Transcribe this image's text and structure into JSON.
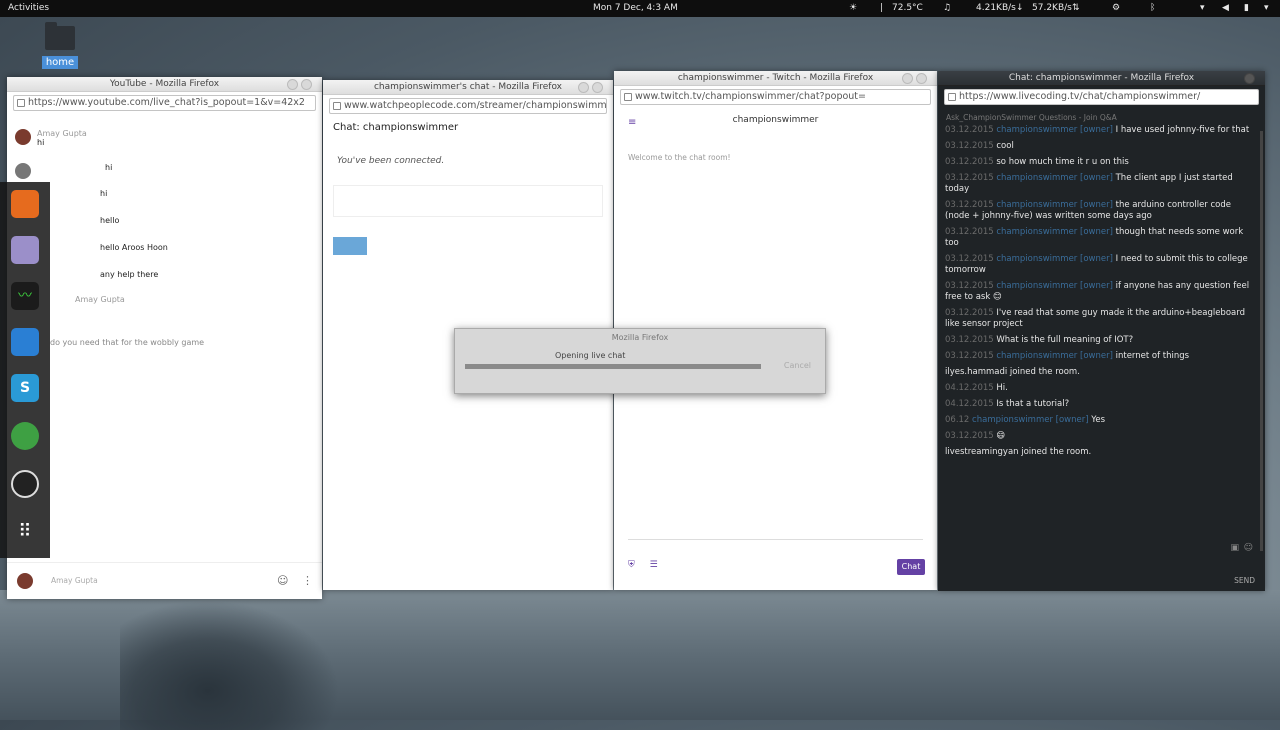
{
  "topbar": {
    "activities": "Activities",
    "clock": "Mon  7 Dec,  4:3 AM",
    "temp": "72.5°C",
    "net_down": "4.21KB/s",
    "net_up": "57.2KB/s"
  },
  "desktop": {
    "home_label": "home"
  },
  "youtube": {
    "title": "YouTube - Mozilla Firefox",
    "url": "https://www.youtube.com/live_chat?is_popout=1&v=42x2",
    "messages": [
      {
        "name": "Amay Gupta",
        "text": "hi"
      },
      {
        "name": "",
        "text": "hi"
      },
      {
        "name": "",
        "text": "hi"
      },
      {
        "name": "",
        "text": "hello"
      },
      {
        "name": "",
        "text": "hello Aroos Hoon"
      },
      {
        "name": "",
        "text": "any help there"
      },
      {
        "name": "Amay Gupta",
        "text": ""
      },
      {
        "name": "",
        "text": "do you need that for the wobbly game"
      }
    ],
    "bottom_name": "Amay Gupta"
  },
  "wpc": {
    "title": "championswimmer's chat - Mozilla Firefox",
    "url": "www.watchpeoplecode.com/streamer/championswimmer",
    "chat_title": "Chat: championswimmer",
    "connected": "You've been connected."
  },
  "twitch": {
    "title": "championswimmer - Twitch - Mozilla Firefox",
    "url": "www.twitch.tv/championswimmer/chat?popout=",
    "channel": "championswimmer",
    "welcome": "Welcome to the chat room!",
    "chat_button": "Chat"
  },
  "livecoding": {
    "title": "Chat: championswimmer - Mozilla Firefox",
    "url": "https://www.livecoding.tv/chat/championswimmer/",
    "subtitle": "Ask_ChampionSwimmer Questions - Join Q&A",
    "send": "SEND",
    "messages": [
      {
        "time": "03.12.2015",
        "user": "championswimmer [owner]",
        "text": "I have used johnny-five for that"
      },
      {
        "time": "03.12.2015",
        "user": "",
        "text": "cool"
      },
      {
        "time": "03.12.2015",
        "user": "",
        "text": "so how much time it r u on this"
      },
      {
        "time": "03.12.2015",
        "user": "championswimmer [owner]",
        "text": "The client app I just started today"
      },
      {
        "time": "03.12.2015",
        "user": "championswimmer [owner]",
        "text": "the arduino controller code (node + johnny-five) was written some days ago"
      },
      {
        "time": "03.12.2015",
        "user": "championswimmer [owner]",
        "text": "though that needs some work too"
      },
      {
        "time": "03.12.2015",
        "user": "championswimmer [owner]",
        "text": "I need to submit this to college tomorrow"
      },
      {
        "time": "03.12.2015",
        "user": "championswimmer [owner]",
        "text": "if anyone has any question feel free to ask 😊"
      },
      {
        "time": "03.12.2015",
        "user": "",
        "text": "I've read that some guy made it the arduino+beagleboard like sensor project"
      },
      {
        "time": "03.12.2015",
        "user": "",
        "text": "What is the full meaning of IOT?"
      },
      {
        "time": "03.12.2015",
        "user": "championswimmer [owner]",
        "text": "internet of things"
      },
      {
        "time": "",
        "user": "",
        "text": "ilyes.hammadi joined the room."
      },
      {
        "time": "04.12.2015",
        "user": "",
        "text": "Hi."
      },
      {
        "time": "04.12.2015",
        "user": "",
        "text": "Is that a tutorial?"
      },
      {
        "time": "06.12",
        "user": "championswimmer [owner]",
        "text": "Yes"
      },
      {
        "time": "03.12.2015",
        "user": "",
        "text": "😄"
      },
      {
        "time": "",
        "user": "",
        "text": "livestreamingyan joined the room."
      }
    ]
  },
  "dialog": {
    "title": "Mozilla Firefox",
    "message": "Opening live chat",
    "button": "Cancel"
  }
}
